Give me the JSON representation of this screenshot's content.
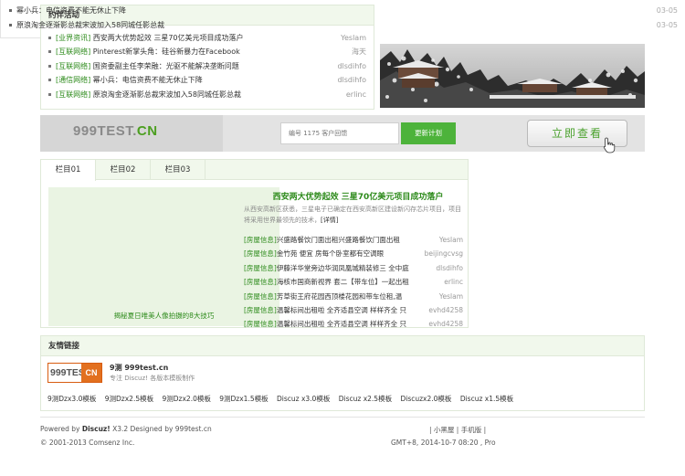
{
  "activities": {
    "title": "约伴活动",
    "items": [
      {
        "tag": "[业界资讯]",
        "title": "西安两大优势起效 三星70亿美元项目成功落户",
        "author": "Yeslam"
      },
      {
        "tag": "[互联网络]",
        "title": "Pinterest新掌头角：硅谷新暴力在Facebook",
        "author": "海天"
      },
      {
        "tag": "[互联网络]",
        "title": "国资委副主任李荣融：光驱不能解决垄断问题",
        "author": "dlsdihfo"
      },
      {
        "tag": "[通信网络]",
        "title": "幂小兵：电信资费不能无休止下降",
        "author": "dlsdihfo"
      },
      {
        "tag": "[互联网络]",
        "title": "原浪淘金逐渐影总裁宋波加入58同城任影总裁",
        "author": "erlinc"
      }
    ]
  },
  "top_news": [
    {
      "title": "幂小兵：电信资费不能无休止下降",
      "date": "03-05"
    },
    {
      "title": "原浪淘金逐渐影总裁宋波加入58同城任影总裁",
      "date": "03-05"
    }
  ],
  "banner": {
    "logo_main": "999TEST.",
    "logo_accent": "CN",
    "search_placeholder": "编号 1175 客户回馈",
    "update_label": "更新计划",
    "view_label": "立即查看"
  },
  "tabs": {
    "labels": [
      "栏目01",
      "栏目02",
      "栏目03"
    ],
    "image_caption": "揭秘夏日唯美人像拍摄的8大技巧",
    "feature_title": "西安两大优势起效 三星70亿美元项目成功落户",
    "feature_desc": "从西安高新区获悉，三星电子已确定在西安高新区建设新闪存芯片项目，项目将采用世界最领先的技术，",
    "feature_detail": "[详情]",
    "houses": [
      {
        "tag": "[房屋信息]",
        "title": "兴盛路餐饮门面出租兴盛路餐饮门面出租",
        "author": "Yeslam"
      },
      {
        "tag": "[房屋信息]",
        "title": "金竹苑 便宜 房每个卧室都有空调眼",
        "author": "beijingcvsg"
      },
      {
        "tag": "[房屋信息]",
        "title": "伊藤洋华堂旁边华润凤凰城精装修三 全中庭",
        "author": "dlsdihfo"
      },
      {
        "tag": "[房屋信息]",
        "title": "海核市国商新视界 套二【带车位】一起出租",
        "author": "erlinc"
      },
      {
        "tag": "[房屋信息]",
        "title": "芳草街王府花园西顶楼花园和带车位租,温",
        "author": "Yeslam"
      },
      {
        "tag": "[房屋信息]",
        "title": "温馨标间出租啦 全齐适县空调 样样齐全 只",
        "author": "evhd4258"
      },
      {
        "tag": "[房屋信息]",
        "title": "温馨标间出租啦 全齐适县空调 样样齐全 只",
        "author": "evhd4258"
      }
    ]
  },
  "links": {
    "title": "友情链接",
    "logo_main": "999TEST.",
    "logo_accent": "CN",
    "site_name": "9测 999test.cn",
    "site_desc": "专注 Discuz! 各版本模板制作",
    "templates": [
      "9测Dzx3.0模板",
      "9测Dzx2.5模板",
      "9测Dzx2.0模板",
      "9测Dzx1.5模板",
      "Discuz x3.0模板",
      "Discuz x2.5模板",
      "Discuzx2.0模板",
      "Discuz x1.5模板"
    ]
  },
  "footer": {
    "powered_prefix": "Powered by ",
    "powered_brand": "Discuz!",
    "powered_suffix": " X3.2 Designed by 999test.cn",
    "copyright": "© 2001-2013 Comsenz Inc.",
    "links": "| 小黑屋 | 手机版 |",
    "time": "GMT+8, 2014-10-7 08:20 , Pro"
  }
}
